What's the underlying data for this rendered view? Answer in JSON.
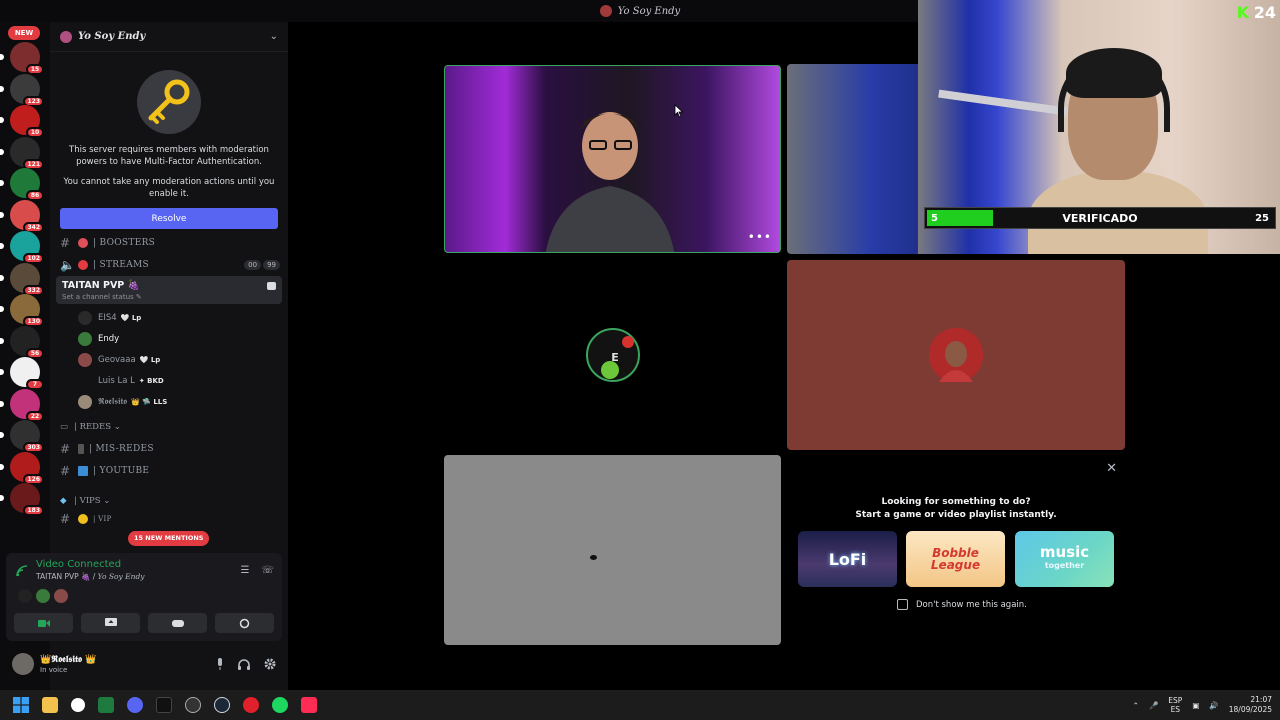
{
  "window": {
    "title": "Yo Soy Endy"
  },
  "rail": {
    "new_label": "NEW",
    "servers": [
      {
        "count": "15",
        "color": "#7d2d2d"
      },
      {
        "count": "123",
        "color": "#3b3b3b"
      },
      {
        "count": "10",
        "color": "#c01d1d"
      },
      {
        "count": "121",
        "color": "#2a2a2a"
      },
      {
        "count": "86",
        "color": "#1f7a3a"
      },
      {
        "count": "342",
        "color": "#d94c4c"
      },
      {
        "count": "102",
        "color": "#1aa39c"
      },
      {
        "count": "332",
        "color": "#5a4a3a"
      },
      {
        "count": "130",
        "color": "#8a6a3a"
      },
      {
        "count": "56",
        "color": "#222222"
      },
      {
        "count": "7",
        "color": "#f0f0f0"
      },
      {
        "count": "22",
        "color": "#c2327a"
      },
      {
        "count": "303",
        "color": "#303030"
      },
      {
        "count": "126",
        "color": "#b01c1c"
      },
      {
        "count": "183",
        "color": "#6a1a1a"
      }
    ]
  },
  "server": {
    "name": "Yo Soy Endy"
  },
  "mfa": {
    "text1": "This server requires members with moderation powers to have Multi-Factor Authentication.",
    "text2": "You cannot take any moderation actions until you enable it.",
    "resolve": "Resolve"
  },
  "channels": {
    "boosters": "| BOOSTERS",
    "streams": "| STREAMS",
    "streams_badges": [
      "00",
      "99"
    ],
    "voice": {
      "name": "TAITAN PVP 🍇",
      "status": "Set a channel status ✎"
    },
    "users": [
      {
        "name": "EIS4",
        "tag": "🤍 Lp",
        "active": false,
        "color": "#2a2a2a",
        "cam": false
      },
      {
        "name": "Endy",
        "tag": "",
        "active": true,
        "color": "#3a7a3a",
        "cam": true
      },
      {
        "name": "Geovaaa",
        "tag": "🤍 Lp",
        "active": false,
        "color": "#8a4a4a",
        "cam": false
      },
      {
        "name": "Luis La L",
        "tag": "✦ BKD",
        "active": false,
        "color": "#121214",
        "cam": false
      },
      {
        "name": "𝕽𝖔𝖊𝖑𝖘𝖎𝖙𝖔",
        "tag": "👑 🛸 LLS",
        "active": false,
        "color": "#9a8a7a",
        "cam": true
      }
    ],
    "redes_cat": "| REDES ⌄",
    "mis_redes": "| MIS-REDES",
    "youtube": "| YOUTUBE",
    "vips_cat": "| VIPS ⌄",
    "vip": "| VIP"
  },
  "mention_pill": "15 NEW MENTIONS",
  "voice_panel": {
    "status": "Video Connected",
    "channel": "TAITAN PVP 🍇 / ",
    "server": "Yo Soy Endy"
  },
  "user": {
    "name": "👑𝕽𝖔𝖊𝖑𝖘𝖎𝖙𝖔 👑",
    "status": "In voice"
  },
  "activity": {
    "line1": "Looking for something to do?",
    "line2": "Start a game or video playlist instantly.",
    "cards": [
      "LoFi",
      "Bobble League",
      "music",
      "together"
    ],
    "dont_show": "Don't show me this again."
  },
  "overlay": {
    "kick_viewers": "24",
    "verify_level": "5",
    "verify_label": "VERIFICADO",
    "verify_max": "25",
    "verify_progress": 0.19
  },
  "taskbar": {
    "lang1": "ESP",
    "lang2": "ES",
    "time": "21:07",
    "date": "18/09/2025"
  },
  "colors": {
    "accent": "#5865f2",
    "connected": "#23a55a",
    "mention": "#e23c42",
    "kick": "#53fc18"
  }
}
